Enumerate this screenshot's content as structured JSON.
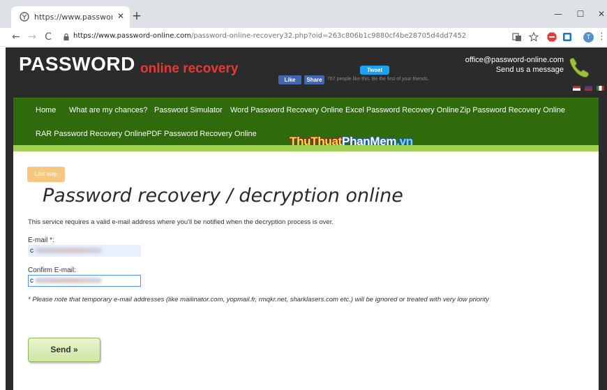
{
  "browser": {
    "tab_title": "https://www.password-online.co",
    "tab_close": "✕",
    "new_tab": "+",
    "window_controls": {
      "minimize": "—",
      "maximize": "☐",
      "close": "✕"
    },
    "nav": {
      "back": "←",
      "forward": "→",
      "reload": "C"
    },
    "url_host": "https://www.password-online.com",
    "url_rest": "/password-online-recovery32.php?oid=263c806b1c9880cf4be28705d4dd7452",
    "profile_initial": "T",
    "menu_dots": "⋮",
    "icons": [
      "globe-icon",
      "lock-icon",
      "translate-icon",
      "star-icon",
      "adblock-icon",
      "extension-icon",
      "profile-icon"
    ]
  },
  "header": {
    "logo_main": "PASSWORD",
    "logo_sub": "online recovery",
    "fb_like": "Like",
    "fb_share": "Share",
    "fb_text": "767 people like this. Be the first of your friends.",
    "tweet": "Tweet",
    "contact_email": "office@password-online.com",
    "contact_message": "Send us a message"
  },
  "menu": {
    "row1": [
      "Home",
      "What are my chances?",
      "Password Simulator",
      "Word Password Recovery Online",
      "Excel Password Recovery Online",
      "Zip Password Recovery Online"
    ],
    "row2": [
      "RAR Password Recovery Online",
      "PDF Password Recovery Online"
    ]
  },
  "watermark": {
    "part1": "ThuThuat",
    "part2": "PhanMem",
    "part3": ".vn"
  },
  "form": {
    "step_badge": "Last step",
    "title": "Password recovery / decryption online",
    "intro": "This service requires a valid e-mail address where you'll be notified when the decryption process is over.",
    "email_label": "E-mail *:",
    "email_value": "c",
    "confirm_label": "Confirm E-mail:",
    "confirm_value": "c",
    "note": "* Please note that temporary e-mail addresses (like mailinator.com, yopmail.fr, rmqkr.net, sharklasers.com etc.) will be ignored or treated with very low priority",
    "send_button": "Send »"
  },
  "colors": {
    "header_bg": "#2b2b2b",
    "menu_green": "#2f6b0c",
    "accent_green": "#9ed14f",
    "logo_red": "#e53935",
    "badge_orange": "#f5c780"
  }
}
